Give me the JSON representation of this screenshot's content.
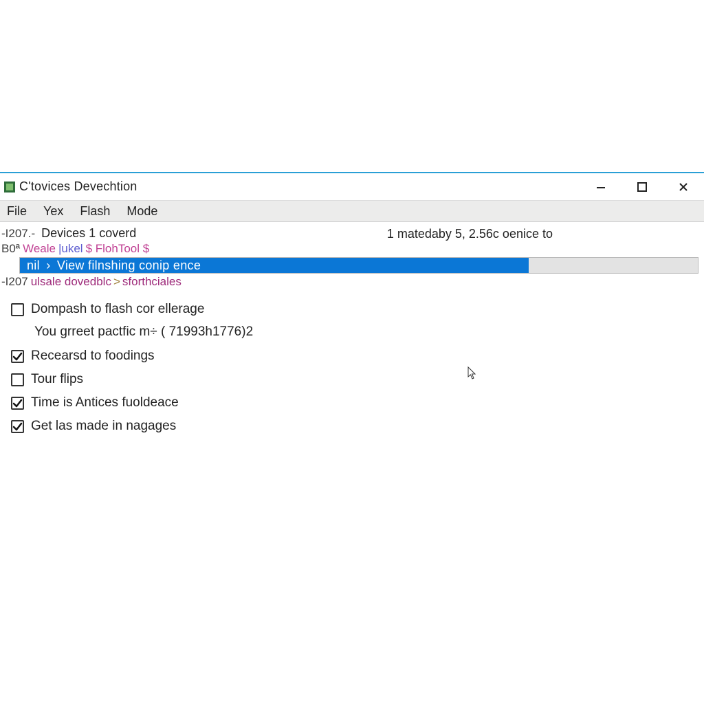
{
  "window": {
    "title": "C'tovices Devechtion"
  },
  "menu": {
    "items": [
      "File",
      "Yex",
      "Flash",
      "Mode"
    ]
  },
  "status": {
    "devices_prefix": "-I207.-",
    "devices_text": "Devices 1 coverd",
    "right_text": "1 matedaby 5, 2.56c oenice to"
  },
  "tool_line": {
    "prefix": "B0ª",
    "weale": "Weale",
    "ikkel": "|ukel",
    "flashtool": "$ FlohTool $"
  },
  "progress": {
    "nil": "nil",
    "arrow": "›",
    "text": "View filnshing conip ence",
    "percent": 75
  },
  "post_line": {
    "prefix": "-I207",
    "uisale": "ulsale dovedblc",
    "gt": ">",
    "sfort": "sforthciales"
  },
  "checks": {
    "c1": {
      "checked": false,
      "label": "Dompash to flash cor ellerage"
    },
    "c1_sub": "You grreet pactfic m÷ ( 71993h1776)2",
    "c2": {
      "checked": true,
      "label": "Recearsd to foodings"
    },
    "c3": {
      "checked": false,
      "label": "Tour flips"
    },
    "c4": {
      "checked": true,
      "label": "Time is Antices fuoldeace"
    },
    "c5": {
      "checked": true,
      "label": "Get las made in nagages"
    }
  }
}
